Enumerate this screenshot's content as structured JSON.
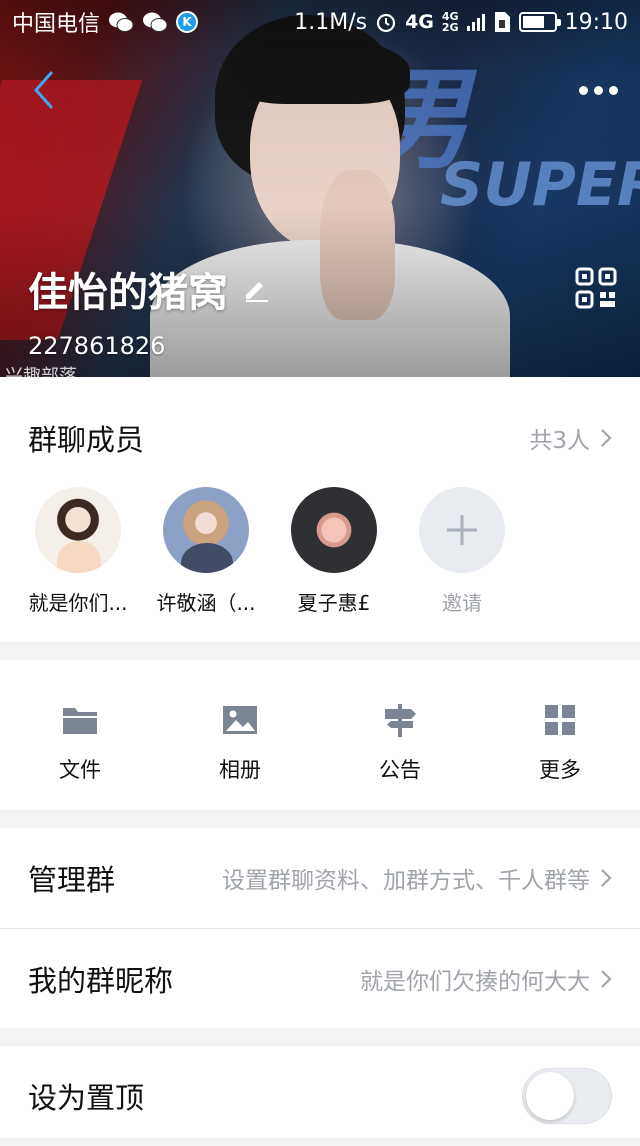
{
  "status_bar": {
    "carrier": "中国电信",
    "net_speed": "1.1M/s",
    "net_type": "4G",
    "sub_top": "4G",
    "sub_bottom": "2G",
    "time": "19:10",
    "battery_level": 0.7,
    "icons": [
      "wechat-icon",
      "wechat-icon",
      "k-app-icon",
      "alarm-icon",
      "signal-icon",
      "sim-icon",
      "battery-icon"
    ]
  },
  "header": {
    "group_name": "佳怡的猪窝",
    "group_id": "227861826",
    "group_tag": "兴趣部落",
    "icons": {
      "back": "back-arrow-icon",
      "more": "more-dots-icon",
      "edit": "edit-pencil-icon",
      "qr": "qr-code-icon"
    }
  },
  "members": {
    "title": "群聊成员",
    "count": "共3人",
    "items": [
      {
        "name": "就是你们..."
      },
      {
        "name": "许敬涵（..."
      },
      {
        "name": "夏子惠£"
      }
    ],
    "invite_label": "邀请"
  },
  "tools": [
    {
      "label": "文件",
      "icon": "folder-icon"
    },
    {
      "label": "相册",
      "icon": "photo-icon"
    },
    {
      "label": "公告",
      "icon": "signpost-icon"
    },
    {
      "label": "更多",
      "icon": "grid-icon"
    }
  ],
  "manage": {
    "title": "管理群",
    "value": "设置群聊资料、加群方式、千人群等"
  },
  "nickname": {
    "title": "我的群昵称",
    "value": "就是你们欠揍的何大大"
  },
  "pin": {
    "title": "设为置顶",
    "enabled": false
  },
  "colors": {
    "accent": "#1e9be9",
    "muted_text": "#a0a4ab",
    "icon_gray": "#7b8593",
    "background": "#f2f3f5"
  }
}
